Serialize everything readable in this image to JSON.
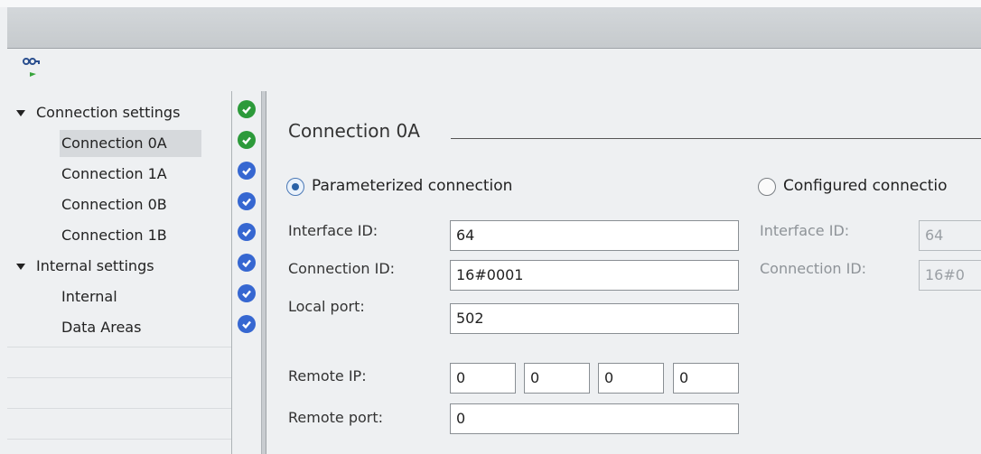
{
  "navigation": {
    "items": [
      {
        "label": "Connection settings",
        "status": "ok"
      },
      {
        "label": "Connection 0A",
        "status": "ok"
      },
      {
        "label": "Connection 1A",
        "status": "info"
      },
      {
        "label": "Connection 0B",
        "status": "info"
      },
      {
        "label": "Connection 1B",
        "status": "info"
      },
      {
        "label": "Internal settings",
        "status": "info"
      },
      {
        "label": "Internal",
        "status": "info"
      },
      {
        "label": "Data Areas",
        "status": "info"
      }
    ],
    "selected": "Connection 0A"
  },
  "status_colors": {
    "ok": "#2c9a3a",
    "info": "#3667d1"
  },
  "toolbar": {
    "icon": "view-connections-icon"
  },
  "main": {
    "section_title": "Connection 0A",
    "parameterized": {
      "label": "Parameterized connection",
      "selected": true,
      "interface_id_label": "Interface ID:",
      "interface_id": "64",
      "connection_id_label": "Connection ID:",
      "connection_id": "16#0001",
      "local_port_label": "Local port:",
      "local_port": "502",
      "remote_ip_label": "Remote IP:",
      "remote_ip": [
        "0",
        "0",
        "0",
        "0"
      ],
      "remote_port_label": "Remote port:",
      "remote_port": "0"
    },
    "configured": {
      "label": "Configured connectio",
      "selected": false,
      "interface_id_label": "Interface ID:",
      "interface_id": "64",
      "connection_id_label": "Connection ID:",
      "connection_id": "16#0"
    }
  }
}
